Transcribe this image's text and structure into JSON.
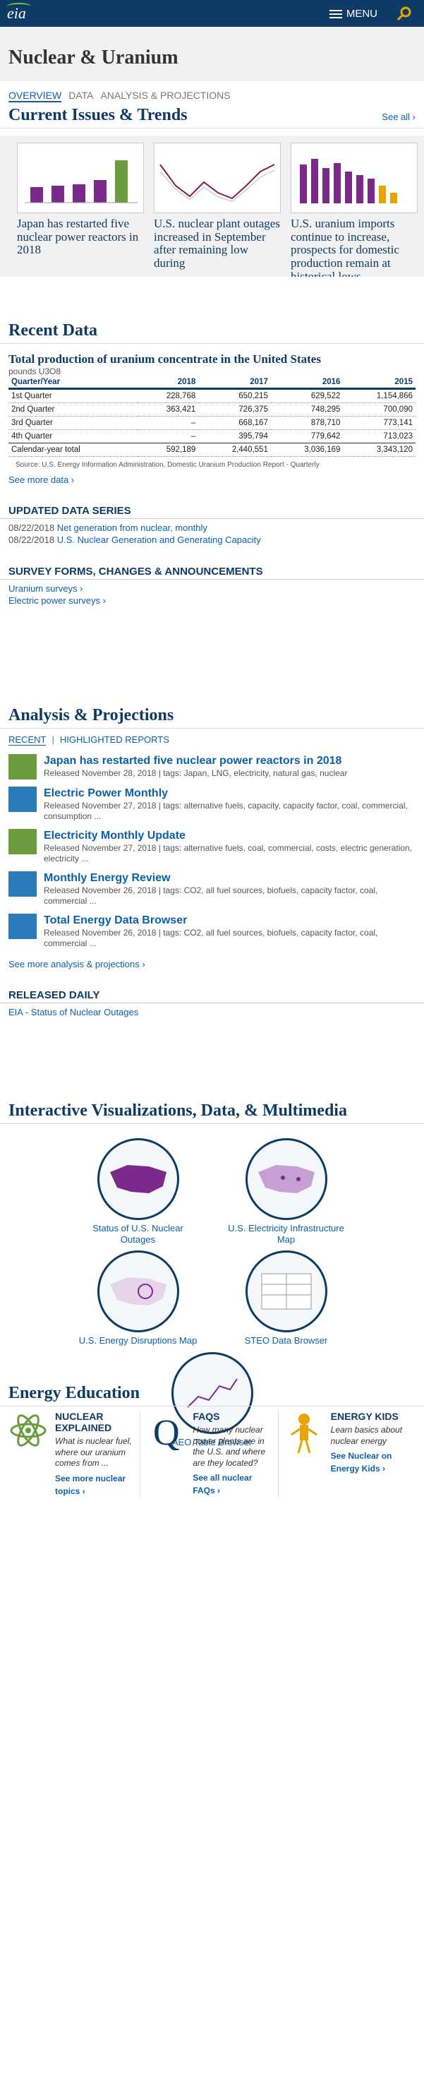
{
  "header": {
    "logo": "eia",
    "menu_label": "MENU"
  },
  "page_title": "Nuclear & Uranium",
  "tabs": [
    {
      "label": "Overview"
    },
    {
      "label": "Data"
    },
    {
      "label": "Analysis & Projections"
    }
  ],
  "current_issues": {
    "heading": "Current Issues & Trends",
    "see_all": "See all ›",
    "cards": [
      {
        "title": "Japan has restarted five nuclear power reactors in 2018"
      },
      {
        "title": "U.S. nuclear plant outages increased in September after remaining low during"
      },
      {
        "title": "U.S. uranium imports continue to increase, prospects for domestic production remain at historical lows"
      }
    ]
  },
  "recent_data": {
    "heading": "Recent Data",
    "table_title": "Total production of uranium concentrate in the United States",
    "unit": "pounds U3O8",
    "columns": [
      "Quarter/Year",
      "2018",
      "2017",
      "2016",
      "2015"
    ],
    "rows": [
      [
        "1st Quarter",
        "228,768",
        "650,215",
        "629,522",
        "1,154,866"
      ],
      [
        "2nd Quarter",
        "363,421",
        "726,375",
        "748,295",
        "700,090"
      ],
      [
        "3rd Quarter",
        "–",
        "668,167",
        "878,710",
        "773,141"
      ],
      [
        "4th Quarter",
        "–",
        "395,794",
        "779,642",
        "713,023"
      ],
      [
        "Calendar-year total",
        "592,189",
        "2,440,551",
        "3,036,169",
        "3,343,120"
      ]
    ],
    "source": "Source: U.S. Energy Information Administration, Domestic Uranium Production Report - Quarterly",
    "see_more": "See more data ›"
  },
  "updated_series": {
    "heading": "UPDATED DATA SERIES",
    "items": [
      {
        "date": "08/22/2018",
        "text": "Net generation from nuclear, monthly"
      },
      {
        "date": "08/22/2018",
        "text": "U.S. Nuclear Generation and Generating Capacity"
      }
    ]
  },
  "survey_forms": {
    "heading": "SURVEY FORMS, CHANGES & ANNOUNCEMENTS",
    "items": [
      {
        "text": "Uranium surveys ›"
      },
      {
        "text": "Electric power surveys ›"
      }
    ]
  },
  "analysis": {
    "heading": "Analysis & Projections",
    "subtabs": [
      {
        "label": "RECENT"
      },
      {
        "label": "HIGHLIGHTED REPORTS"
      }
    ],
    "reports": [
      {
        "title": "Japan has restarted five nuclear power reactors in 2018",
        "meta": "Released November 28, 2018 | tags: Japan, LNG, electricity, natural gas, nuclear"
      },
      {
        "title": "Electric Power Monthly",
        "meta": "Released November 27, 2018 | tags: alternative fuels, capacity, capacity factor, coal, commercial, consumption ..."
      },
      {
        "title": "Electricity Monthly Update",
        "meta": "Released November 27, 2018 | tags: alternative fuels, coal, commercial, costs, electric generation, electricity ..."
      },
      {
        "title": "Monthly Energy Review",
        "meta": "Released November 26, 2018 | tags: CO2, all fuel sources, biofuels, capacity factor, coal, commercial ..."
      },
      {
        "title": "Total Energy Data Browser",
        "meta": "Released November 26, 2018 | tags: CO2, all fuel sources, biofuels, capacity factor, coal, commercial ..."
      }
    ],
    "see_more": "See more analysis & projections ›",
    "released_daily": "RELEASED DAILY",
    "daily_item": "EIA - Status of Nuclear Outages"
  },
  "interactive": {
    "heading": "Interactive Visualizations, Data, & Multimedia",
    "items": [
      {
        "label": "Status of U.S. Nuclear Outages"
      },
      {
        "label": "U.S. Electricity Infrastructure Map"
      },
      {
        "label": "U.S. Energy Disruptions Map"
      },
      {
        "label": "STEO Data Browser"
      },
      {
        "label": "AEO Table Browser"
      }
    ]
  },
  "education": {
    "heading": "Energy Education",
    "items": [
      {
        "title": "NUCLEAR EXPLAINED",
        "desc": "What is nuclear fuel, where our uranium comes from ...",
        "link": "See more nuclear topics ›"
      },
      {
        "title": "FAQS",
        "desc": "How many nuclear power plants are in the U.S. and where are they located?",
        "link": "See all nuclear FAQs ›"
      },
      {
        "title": "ENERGY KIDS",
        "desc": "Learn basics about nuclear energy",
        "link": "See Nuclear on Energy Kids ›"
      }
    ]
  },
  "colors": {
    "brand_dark": "#0d3b66",
    "link": "#0b60a8",
    "accent_green": "#7fc241"
  }
}
